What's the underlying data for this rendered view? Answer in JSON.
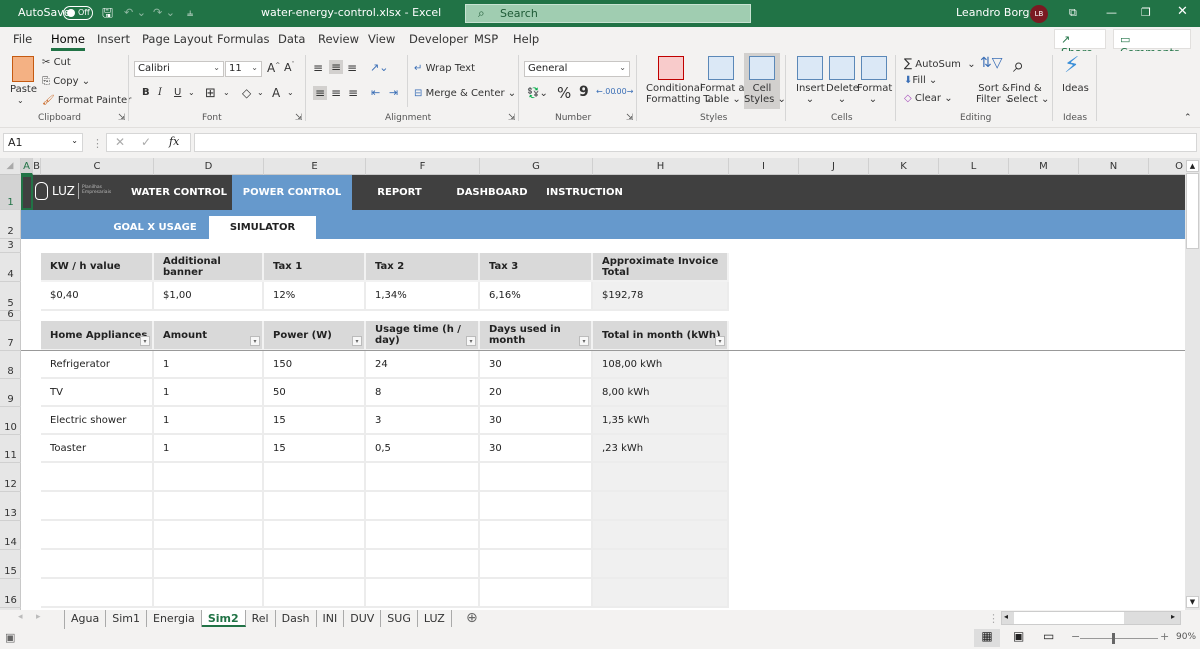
{
  "titlebar": {
    "autosave_label": "AutoSave",
    "autosave_state": "Off",
    "file_title": "water-energy-control.xlsx  -  Excel",
    "search_placeholder": "Search",
    "user_name": "Leandro Borges",
    "user_initials": "LB"
  },
  "menu": {
    "tabs": [
      "File",
      "Home",
      "Insert",
      "Page Layout",
      "Formulas",
      "Data",
      "Review",
      "View",
      "Developer",
      "MSP",
      "Help"
    ],
    "active": "Home",
    "share_label": "Share",
    "comments_label": "Comments"
  },
  "ribbon": {
    "clipboard": {
      "paste": "Paste",
      "cut": "Cut",
      "copy": "Copy",
      "format_painter": "Format Painter",
      "group": "Clipboard"
    },
    "font": {
      "name": "Calibri",
      "size": "11",
      "bold": "B",
      "italic": "I",
      "underline": "U",
      "group": "Font"
    },
    "alignment": {
      "wrap": "Wrap Text",
      "merge": "Merge & Center",
      "group": "Alignment"
    },
    "number": {
      "format": "General",
      "percent": "%",
      "comma": "9",
      "group": "Number"
    },
    "styles": {
      "conditional": "Conditional",
      "conditional2": "Formatting",
      "format_table": "Format as",
      "format_table2": "Table",
      "cell_styles": "Cell",
      "cell_styles2": "Styles",
      "group": "Styles"
    },
    "cells": {
      "insert": "Insert",
      "delete": "Delete",
      "format": "Format",
      "group": "Cells"
    },
    "editing": {
      "autosum": "AutoSum",
      "fill": "Fill",
      "clear": "Clear",
      "sort": "Sort &",
      "sort2": "Filter",
      "find": "Find &",
      "find2": "Select",
      "group": "Editing"
    },
    "ideas": {
      "label": "Ideas",
      "group": "Ideas"
    }
  },
  "formula_bar": {
    "name_box": "A1",
    "fx": "fx",
    "formula": ""
  },
  "columns": [
    "A",
    "B",
    "C",
    "D",
    "E",
    "F",
    "G",
    "H",
    "I",
    "J",
    "K",
    "L",
    "M",
    "N",
    "O"
  ],
  "rows": [
    "1",
    "2",
    "3",
    "4",
    "5",
    "6",
    "7",
    "8",
    "9",
    "10",
    "11",
    "12",
    "13",
    "14",
    "15",
    "16"
  ],
  "nav": {
    "logo": "LUZ",
    "logo_sub": "Planilhas Empresariais",
    "items": [
      "WATER CONTROL",
      "POWER CONTROL",
      "REPORT",
      "DASHBOARD",
      "INSTRUCTION"
    ],
    "active": "POWER CONTROL",
    "subitems": [
      "GOAL X USAGE",
      "SIMULATOR"
    ],
    "sub_active": "SIMULATOR"
  },
  "params": {
    "headers": [
      "KW / h value",
      "Additional banner",
      "Tax 1",
      "Tax 2",
      "Tax 3",
      "Approximate Invoice Total"
    ],
    "values": [
      "$0,40",
      "$1,00",
      "12%",
      "1,34%",
      "6,16%",
      "$192,78"
    ]
  },
  "appliances": {
    "headers": [
      "Home Appliances",
      "Amount",
      "Power (W)",
      "Usage time (h / day)",
      "Days used in month",
      "Total in month (kWh)"
    ],
    "rows": [
      [
        "Refrigerator",
        "1",
        "150",
        "24",
        "30",
        "108,00 kWh"
      ],
      [
        "TV",
        "1",
        "50",
        "8",
        "20",
        "8,00 kWh"
      ],
      [
        "Electric shower",
        "1",
        "15",
        "3",
        "30",
        "1,35 kWh"
      ],
      [
        "Toaster",
        "1",
        "15",
        "0,5",
        "30",
        ",23 kWh"
      ]
    ]
  },
  "sheet_tabs": [
    "Agua",
    "Sim1",
    "Energia",
    "Sim2",
    "Rel",
    "Dash",
    "INI",
    "DUV",
    "SUG",
    "LUZ"
  ],
  "active_sheet": "Sim2",
  "status": {
    "zoom": "90%"
  }
}
